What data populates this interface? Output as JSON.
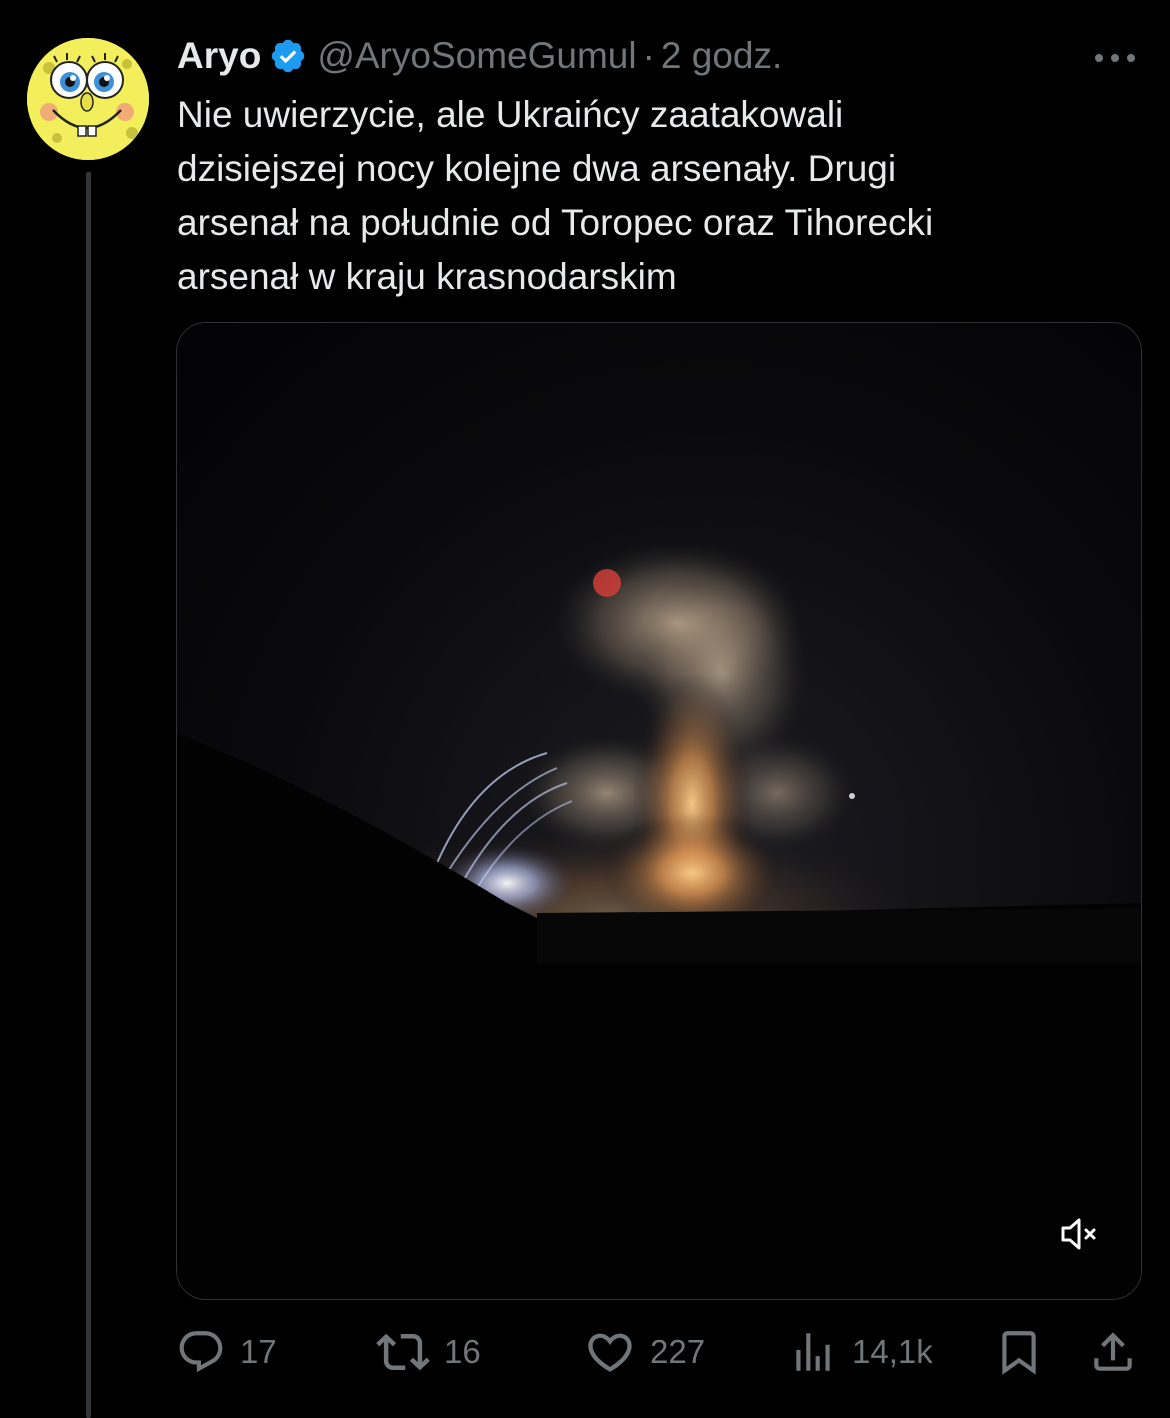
{
  "tweet": {
    "author": {
      "display_name": "Aryo",
      "handle": "@AryoSomeGumul",
      "verified": true,
      "avatar_icon": "spongebob-smile-avatar"
    },
    "separator": "·",
    "time": "2 godz.",
    "text_lines": [
      "Nie uwierzycie, ale Ukraińcy zaatakowali",
      "dzisiejszej nocy kolejne dwa arsenały. Drugi",
      "arsenał na południe od Toropec oraz Tihorecki",
      "arsenał w kraju krasnodarskim"
    ],
    "media": {
      "type": "video",
      "muted": true,
      "mute_icon": "speaker-muted-icon"
    },
    "actions": {
      "replies": "17",
      "reposts": "16",
      "likes": "227",
      "views": "14,1k"
    }
  },
  "colors": {
    "background": "#000000",
    "text_primary": "#e7e9ea",
    "text_secondary": "#71767b",
    "verified_blue": "#1d9bf0",
    "border": "#2f3336"
  }
}
